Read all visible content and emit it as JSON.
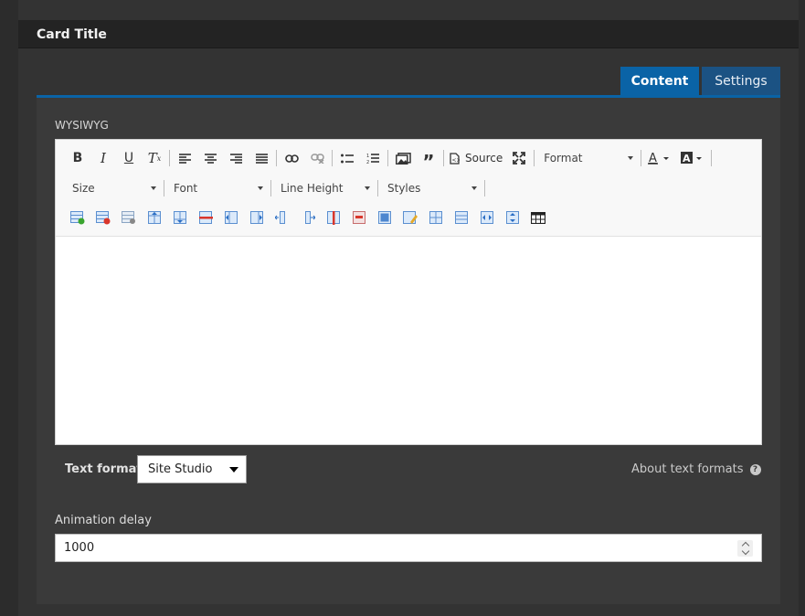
{
  "card": {
    "title": "Card Title"
  },
  "tabs": [
    {
      "label": "Content",
      "active": true
    },
    {
      "label": "Settings",
      "active": false
    }
  ],
  "field": {
    "label": "WYSIWYG"
  },
  "toolbar": {
    "row1": [
      "bold-icon",
      "italic-icon",
      "underline-icon",
      "remove-format-icon",
      "align-left-icon",
      "align-center-icon",
      "align-right-icon",
      "justify-icon",
      "link-icon",
      "unlink-icon",
      "bulleted-list-icon",
      "numbered-list-icon",
      "image-icon",
      "blockquote-icon",
      "source-icon",
      "maximize-icon"
    ],
    "source_label": "Source",
    "format_label": "Format",
    "size_label": "Size",
    "font_label": "Font",
    "line_height_label": "Line Height",
    "styles_label": "Styles"
  },
  "text_format": {
    "label": "Text format",
    "selected": "Site Studio",
    "about_link": "About text formats"
  },
  "animation": {
    "label": "Animation delay",
    "value": "1000"
  },
  "colors": {
    "accent": "#0a63a6",
    "tab_inactive": "#1b5283",
    "panel": "#3a3a3a"
  }
}
